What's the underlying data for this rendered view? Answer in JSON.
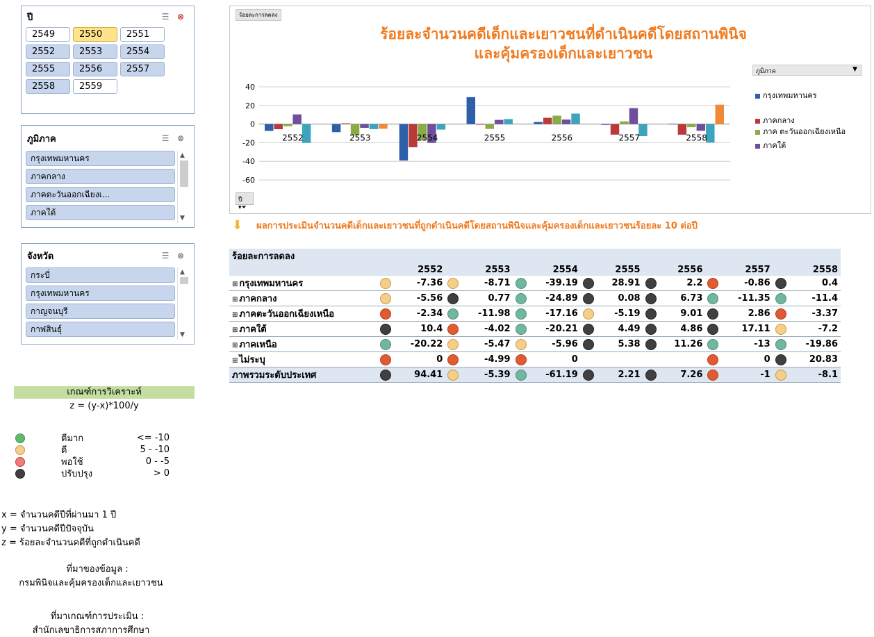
{
  "slicers": {
    "year": {
      "title": "ปี",
      "items": [
        "2549",
        "2550",
        "2551",
        "2552",
        "2553",
        "2554",
        "2555",
        "2556",
        "2557",
        "2558",
        "2559"
      ]
    },
    "region": {
      "title": "ภูมิภาค",
      "items": [
        "กรุงเทพมหานคร",
        "ภาคกลาง",
        "ภาคตะวันออกเฉียงเ...",
        "ภาคใต้"
      ]
    },
    "province": {
      "title": "จังหวัด",
      "items": [
        "กระบี่",
        "กรุงเทพมหานคร",
        "กาญจนบุรี",
        "กาฬสินธุ์"
      ]
    }
  },
  "chart": {
    "field_button": "ร้อยละการลดลง",
    "title_line1": "ร้อยละจำนวนคดีเด็กและเยาวชนที่ดำเนินคดีโดยสถานพินิจ",
    "title_line2": "และคุ้มครองเด็กและเยาวชน",
    "legend_header": "ภูมิภาค",
    "filter_label": "ปี"
  },
  "chart_data": {
    "type": "bar",
    "categories": [
      "2552",
      "2553",
      "2554",
      "2555",
      "2556",
      "2557",
      "2558"
    ],
    "ylim": [
      -60,
      40
    ],
    "yticks": [
      40,
      20,
      0,
      -20,
      -40,
      -60
    ],
    "grid": true,
    "legend_position": "right",
    "series": [
      {
        "name": "กรุงเทพมหานคร",
        "color": "#2e5fa8",
        "values": [
          -7.36,
          -8.71,
          -39.19,
          28.91,
          2.2,
          -0.86,
          0.4
        ]
      },
      {
        "name": "ภาคกลาง",
        "color": "#b83b39",
        "values": [
          -5.56,
          0.77,
          -24.89,
          0.08,
          6.73,
          -11.35,
          -11.4
        ]
      },
      {
        "name": "ภาคตะวันออกเฉียงเหนือ",
        "color": "#8aab45",
        "values": [
          -2.34,
          -11.98,
          -17.16,
          -5.19,
          9.01,
          2.86,
          -3.37
        ]
      },
      {
        "name": "ภาคใต้",
        "color": "#6f4f9c",
        "values": [
          10.4,
          -4.02,
          -20.21,
          4.49,
          4.86,
          17.11,
          -7.2
        ]
      },
      {
        "name": "ภาคเหนือ",
        "color": "#3ca5bd",
        "values": [
          -20.22,
          -5.47,
          -5.96,
          5.38,
          11.26,
          -13,
          -19.86
        ]
      },
      {
        "name": "ไม่ระบุ",
        "color": "#f08a36",
        "values": [
          0,
          -4.99,
          0,
          null,
          null,
          0,
          20.83
        ]
      }
    ]
  },
  "legend_items": [
    {
      "label": "กรุงเทพมหานคร",
      "color": "#2e5fa8"
    },
    {
      "label": "ภาคกลาง",
      "color": "#b83b39"
    },
    {
      "label": "ภาค ตะวันออกเฉียงเหนือ",
      "color": "#8aab45"
    },
    {
      "label": "ภาคใต้",
      "color": "#6f4f9c"
    }
  ],
  "note": "ผลการประเมินจำนวนคดีเด็กและเยาวชนที่ถูกดำเนินคดีโดยสถานพินิจและคุ้มครองเด็กและเยาวชนร้อยละ 10 ต่อปี",
  "table": {
    "header": "ร้อยละการลดลง",
    "years": [
      "2552",
      "2553",
      "2554",
      "2555",
      "2556",
      "2557",
      "2558"
    ],
    "rows": [
      {
        "label": "กรุงเทพมหานคร",
        "cells": [
          {
            "v": "-7.36",
            "i": "yellow"
          },
          {
            "v": "-8.71",
            "i": "yellow"
          },
          {
            "v": "-39.19",
            "i": "green"
          },
          {
            "v": "28.91",
            "i": "black"
          },
          {
            "v": "2.2",
            "i": "black"
          },
          {
            "v": "-0.86",
            "i": "red"
          },
          {
            "v": "0.4",
            "i": "black"
          }
        ]
      },
      {
        "label": "ภาคกลาง",
        "cells": [
          {
            "v": "-5.56",
            "i": "yellow"
          },
          {
            "v": "0.77",
            "i": "black"
          },
          {
            "v": "-24.89",
            "i": "green"
          },
          {
            "v": "0.08",
            "i": "black"
          },
          {
            "v": "6.73",
            "i": "black"
          },
          {
            "v": "-11.35",
            "i": "green"
          },
          {
            "v": "-11.4",
            "i": "green"
          }
        ]
      },
      {
        "label": "ภาคตะวันออกเฉียงเหนือ",
        "cells": [
          {
            "v": "-2.34",
            "i": "red"
          },
          {
            "v": "-11.98",
            "i": "green"
          },
          {
            "v": "-17.16",
            "i": "green"
          },
          {
            "v": "-5.19",
            "i": "yellow"
          },
          {
            "v": "9.01",
            "i": "black"
          },
          {
            "v": "2.86",
            "i": "black"
          },
          {
            "v": "-3.37",
            "i": "red"
          }
        ]
      },
      {
        "label": "ภาคใต้",
        "cells": [
          {
            "v": "10.4",
            "i": "black"
          },
          {
            "v": "-4.02",
            "i": "red"
          },
          {
            "v": "-20.21",
            "i": "green"
          },
          {
            "v": "4.49",
            "i": "black"
          },
          {
            "v": "4.86",
            "i": "black"
          },
          {
            "v": "17.11",
            "i": "black"
          },
          {
            "v": "-7.2",
            "i": "yellow"
          }
        ]
      },
      {
        "label": "ภาคเหนือ",
        "cells": [
          {
            "v": "-20.22",
            "i": "green"
          },
          {
            "v": "-5.47",
            "i": "yellow"
          },
          {
            "v": "-5.96",
            "i": "yellow"
          },
          {
            "v": "5.38",
            "i": "black"
          },
          {
            "v": "11.26",
            "i": "black"
          },
          {
            "v": "-13",
            "i": "green"
          },
          {
            "v": "-19.86",
            "i": "green"
          }
        ]
      },
      {
        "label": "ไม่ระบุ",
        "cells": [
          {
            "v": "0",
            "i": "red"
          },
          {
            "v": "-4.99",
            "i": "red"
          },
          {
            "v": "0",
            "i": "red"
          },
          {
            "v": "",
            "i": ""
          },
          {
            "v": "",
            "i": ""
          },
          {
            "v": "0",
            "i": "red"
          },
          {
            "v": "20.83",
            "i": "black"
          }
        ]
      }
    ],
    "total": {
      "label": "ภาพรวมระดับประเทศ",
      "cells": [
        {
          "v": "94.41",
          "i": "black"
        },
        {
          "v": "-5.39",
          "i": "yellow"
        },
        {
          "v": "-61.19",
          "i": "green"
        },
        {
          "v": "2.21",
          "i": "black"
        },
        {
          "v": "7.26",
          "i": "black"
        },
        {
          "v": "-1",
          "i": "red"
        },
        {
          "v": "-8.1",
          "i": "yellow"
        }
      ]
    }
  },
  "criteria": {
    "title": "เกณฑ์การวิเคราะห์",
    "formula": "z = (y-x)*100/y",
    "levels": [
      {
        "color": "green",
        "name": "ดีมาก",
        "range": "<= -10"
      },
      {
        "color": "yellow",
        "name": "ดี",
        "range": "5 - -10"
      },
      {
        "color": "red",
        "name": "พอใช้",
        "range": "0 - -5"
      },
      {
        "color": "black",
        "name": "ปรับปรุง",
        "range": "> 0"
      }
    ],
    "defs": [
      "x = จำนวนคดีปีที่ผ่านมา 1 ปี",
      "y = จำนวนคดีปีปัจจุบัน",
      "z = ร้อยละจำนวนคดีที่ถูกดำเนินคดี"
    ],
    "source_label": "ที่มาของข้อมูล :",
    "source": "กรมพินิจและคุ้มครองเด็กและเยาวชน",
    "criteria_source_label": "ที่มาเกณฑ์การประเมิน :",
    "criteria_source": "สำนักเลขาธิการสภาการศึกษา"
  }
}
